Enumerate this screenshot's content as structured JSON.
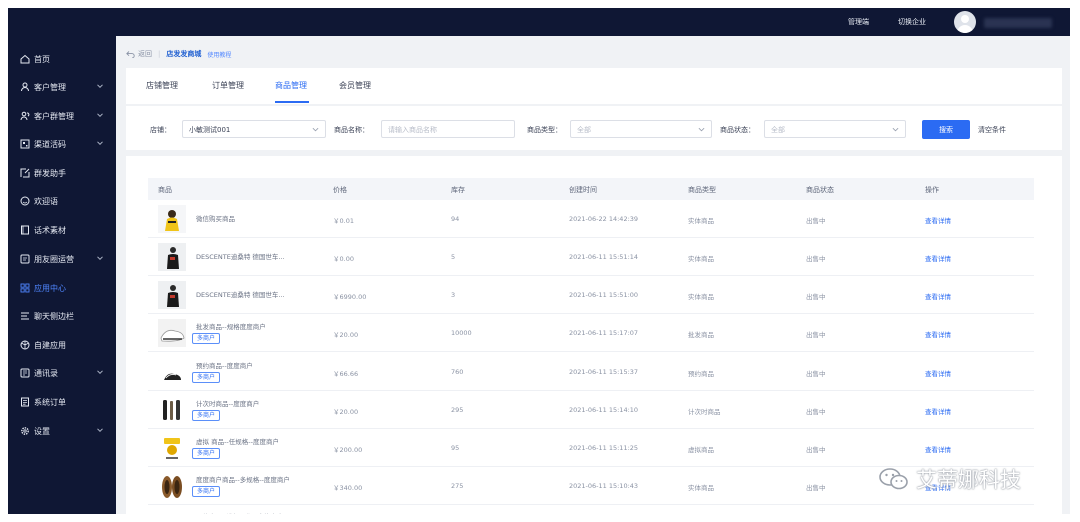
{
  "topbar": {
    "admin_label": "管理端",
    "switch_label": "切换企业"
  },
  "sidebar": {
    "items": [
      {
        "label": "首页",
        "icon": "home-icon",
        "has_chevron": false,
        "active": false
      },
      {
        "label": "客户管理",
        "icon": "user-icon",
        "has_chevron": true,
        "active": false
      },
      {
        "label": "客户群管理",
        "icon": "group-icon",
        "has_chevron": true,
        "active": false
      },
      {
        "label": "渠道活码",
        "icon": "qrcode-icon",
        "has_chevron": true,
        "active": false
      },
      {
        "label": "群发助手",
        "icon": "send-icon",
        "has_chevron": false,
        "active": false
      },
      {
        "label": "欢迎语",
        "icon": "smile-icon",
        "has_chevron": false,
        "active": false
      },
      {
        "label": "话术素材",
        "icon": "book-icon",
        "has_chevron": false,
        "active": false
      },
      {
        "label": "朋友圈运营",
        "icon": "moments-icon",
        "has_chevron": true,
        "active": false
      },
      {
        "label": "应用中心",
        "icon": "apps-icon",
        "has_chevron": false,
        "active": true
      },
      {
        "label": "聊天侧边栏",
        "icon": "menu-icon",
        "has_chevron": false,
        "active": false
      },
      {
        "label": "自建应用",
        "icon": "cube-icon",
        "has_chevron": false,
        "active": false
      },
      {
        "label": "通讯录",
        "icon": "contacts-icon",
        "has_chevron": true,
        "active": false
      },
      {
        "label": "系统订单",
        "icon": "order-icon",
        "has_chevron": false,
        "active": false
      },
      {
        "label": "设置",
        "icon": "gear-icon",
        "has_chevron": true,
        "active": false
      }
    ]
  },
  "breadcrumb": {
    "back": "返回",
    "current": "店发发商城",
    "tutorial": "使用教程"
  },
  "tabs": [
    {
      "label": "店铺管理"
    },
    {
      "label": "订单管理"
    },
    {
      "label": "商品管理"
    },
    {
      "label": "会员管理"
    }
  ],
  "filters": {
    "shop_label": "店铺：",
    "shop_value": "小敏测试001",
    "name_label": "商品名称：",
    "name_placeholder": "请输入商品名称",
    "type_label": "商品类型：",
    "type_value": "全部",
    "status_label": "商品状态：",
    "status_value": "全部",
    "search_button": "搜索",
    "clear_button": "清空条件"
  },
  "table": {
    "headers": [
      "商品",
      "价格",
      "库存",
      "创建时间",
      "商品类型",
      "商品状态",
      "操作"
    ],
    "rows": [
      {
        "name": "微信购买商品",
        "tag": "",
        "price": "￥0.01",
        "stock": "94",
        "created": "2021-06-22 14:42:39",
        "type": "实体商品",
        "status": "出售中",
        "action": "查看详情"
      },
      {
        "name": "DESCENTE迪桑特 德国世车...",
        "tag": "",
        "price": "￥0.00",
        "stock": "5",
        "created": "2021-06-11 15:51:14",
        "type": "实体商品",
        "status": "出售中",
        "action": "查看详情"
      },
      {
        "name": "DESCENTE迪桑特 德国世车...",
        "tag": "",
        "price": "￥6990.00",
        "stock": "3",
        "created": "2021-06-11 15:51:00",
        "type": "实体商品",
        "status": "出售中",
        "action": "查看详情"
      },
      {
        "name": "批发商品--规格度度商户",
        "tag": "多商户",
        "price": "￥20.00",
        "stock": "10000",
        "created": "2021-06-11 15:17:07",
        "type": "批发商品",
        "status": "出售中",
        "action": "查看详情"
      },
      {
        "name": "预约商品--度度商户",
        "tag": "多商户",
        "price": "￥66.66",
        "stock": "760",
        "created": "2021-06-11 15:15:37",
        "type": "预约商品",
        "status": "出售中",
        "action": "查看详情"
      },
      {
        "name": "计次时商品--度度商户",
        "tag": "多商户",
        "price": "￥20.00",
        "stock": "295",
        "created": "2021-06-11 15:14:10",
        "type": "计次时商品",
        "status": "出售中",
        "action": "查看详情"
      },
      {
        "name": "虚拟 商品--任规格--度度商户",
        "tag": "多商户",
        "price": "￥200.00",
        "stock": "95",
        "created": "2021-06-11 15:11:25",
        "type": "虚拟商品",
        "status": "出售中",
        "action": "查看详情"
      },
      {
        "name": "度度商户商品--多规格--度度商户",
        "tag": "多商户",
        "price": "￥340.00",
        "stock": "275",
        "created": "2021-06-11 15:10:43",
        "type": "实体商品",
        "status": "出售中",
        "action": "查看详情"
      }
    ],
    "partial_row_name": "预约商品--选择日期--度均商户"
  },
  "watermark": {
    "text": "艾蒂娜科技"
  }
}
